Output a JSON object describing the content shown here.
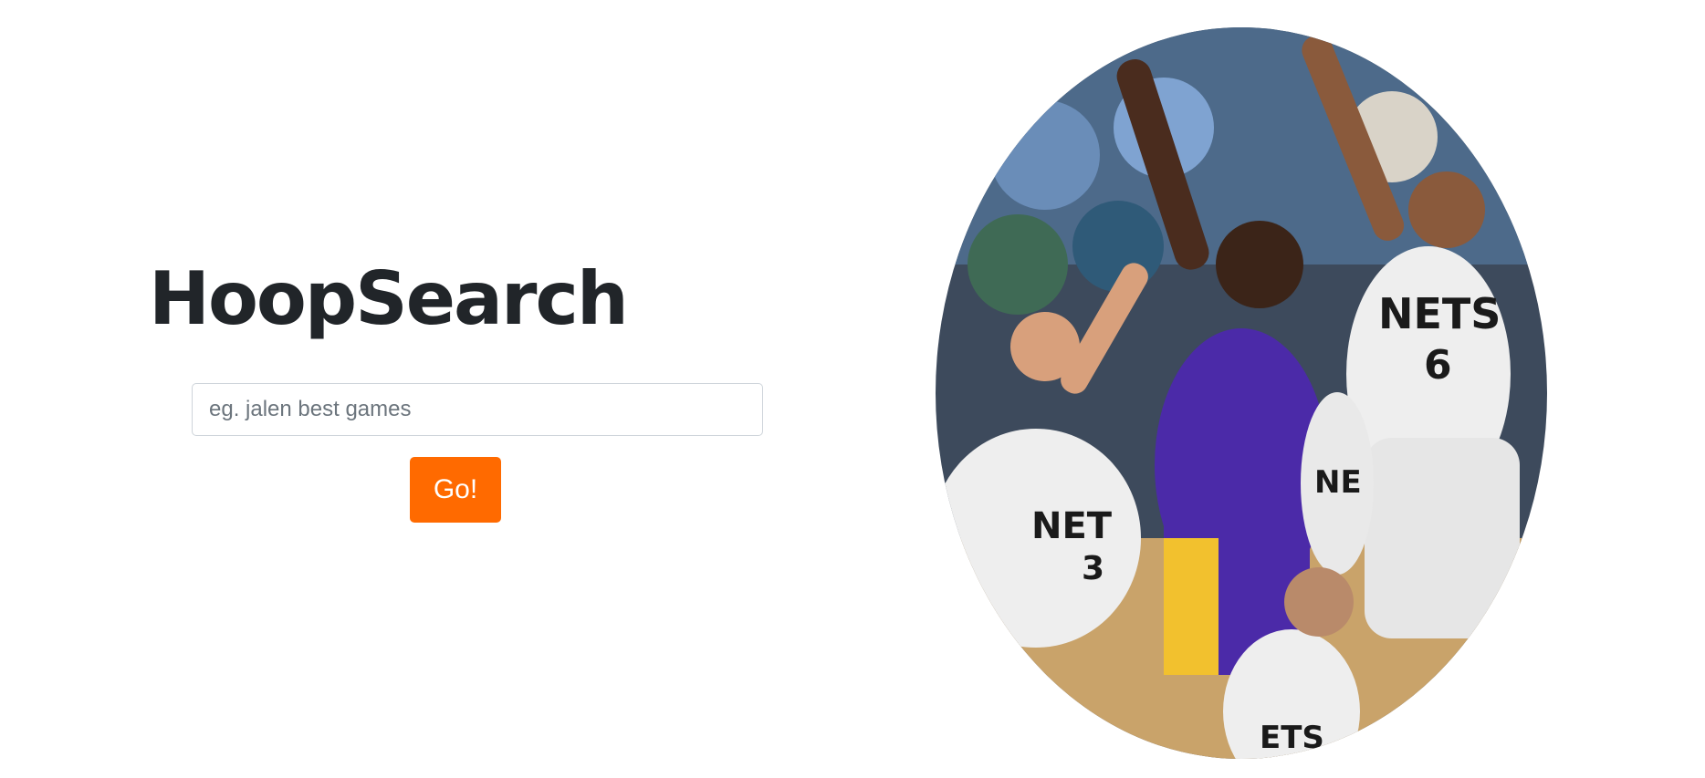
{
  "app": {
    "title": "HoopSearch"
  },
  "search": {
    "placeholder": "eg. jalen best games",
    "value": "",
    "button_label": "Go!"
  },
  "hero_image": {
    "description_icon": "basketball-photo",
    "jerseys": {
      "nets_a": "NETS",
      "nets_a_number": "6",
      "nets_b": "NET",
      "nets_b_number": "3",
      "nets_c": "NE",
      "nets_d": "ETS"
    }
  },
  "colors": {
    "accent": "#ff6a00",
    "title": "#212529",
    "lakers_purple": "#4b2aa8",
    "lakers_gold": "#f2c12e",
    "nets_white": "#eeeeee"
  }
}
